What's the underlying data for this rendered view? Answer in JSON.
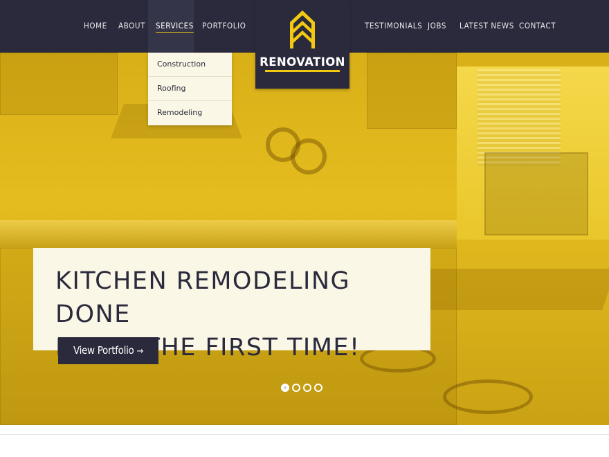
{
  "nav": {
    "left": [
      {
        "label": "HOME"
      },
      {
        "label": "ABOUT"
      },
      {
        "label": "SERVICES"
      },
      {
        "label": "PORTFOLIO"
      }
    ],
    "right": [
      {
        "label": "TESTIMONIALS"
      },
      {
        "label": "JOBS"
      },
      {
        "label": "LATEST NEWS"
      },
      {
        "label": "CONTACT"
      }
    ],
    "active": "SERVICES"
  },
  "logo": {
    "text": "RENOVATION",
    "icon": "chevron-up-logo-icon"
  },
  "dropdown": {
    "items": [
      {
        "label": "Construction"
      },
      {
        "label": "Roofing"
      },
      {
        "label": "Remodeling"
      }
    ]
  },
  "hero": {
    "headline_line1": "KITCHEN REMODELING DONE",
    "headline_line2": "RIGHT THE FIRST TIME!",
    "cta_label": "View Portfolio",
    "cta_arrow": "→",
    "slides_total": 4,
    "active_slide": 1
  },
  "colors": {
    "nav_bg": "#2a2a3c",
    "accent": "#f2c811",
    "hero_tint": "#e3b91a",
    "panel_bg": "#fbf7e6"
  }
}
